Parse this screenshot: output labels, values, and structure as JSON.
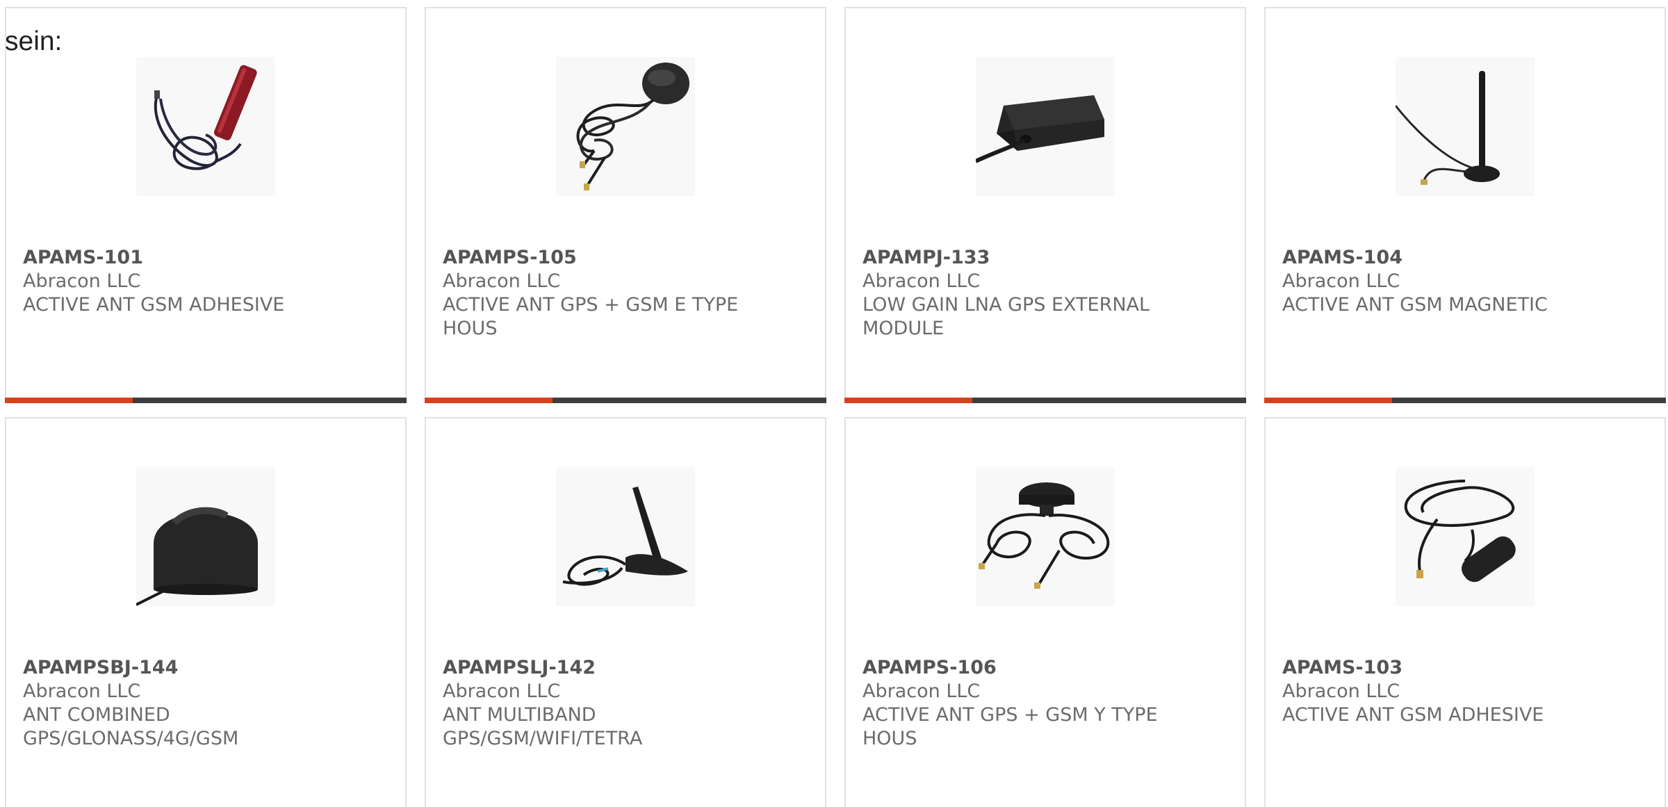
{
  "intro_text": "sein:",
  "colors": {
    "accent": "#d9401a",
    "bar": "#3d3d3d",
    "border": "#e1e1e1",
    "text": "#6b6b6b"
  },
  "products": [
    {
      "part_number": "APAMS-101",
      "manufacturer": "Abracon LLC",
      "description": "ACTIVE ANT GSM ADHESIVE",
      "image_icon": "stick-antenna-with-cable-icon"
    },
    {
      "part_number": "APAMPS-105",
      "manufacturer": "Abracon LLC",
      "description": "ACTIVE ANT GPS + GSM E TYPE HOUS",
      "image_icon": "puck-antenna-with-cables-icon"
    },
    {
      "part_number": "APAMPJ-133",
      "manufacturer": "Abracon LLC",
      "description": "LOW GAIN LNA GPS EXTERNAL MODULE",
      "image_icon": "gps-module-icon"
    },
    {
      "part_number": "APAMS-104",
      "manufacturer": "Abracon LLC",
      "description": "ACTIVE ANT GSM MAGNETIC",
      "image_icon": "magnetic-whip-antenna-icon"
    },
    {
      "part_number": "APAMPSBJ-144",
      "manufacturer": "Abracon LLC",
      "description": "ANT COMBINED GPS/GLONASS/4G/GSM",
      "image_icon": "dome-antenna-icon"
    },
    {
      "part_number": "APAMPSLJ-142",
      "manufacturer": "Abracon LLC",
      "description": "ANT MULTIBAND GPS/GSM/WIFI/TETRA",
      "image_icon": "shark-fin-antenna-icon"
    },
    {
      "part_number": "APAMPS-106",
      "manufacturer": "Abracon LLC",
      "description": "ACTIVE ANT GPS + GSM Y TYPE HOUS",
      "image_icon": "puck-antenna-with-cables-icon"
    },
    {
      "part_number": "APAMS-103",
      "manufacturer": "Abracon LLC",
      "description": "ACTIVE ANT GSM ADHESIVE",
      "image_icon": "flat-adhesive-antenna-icon"
    }
  ]
}
